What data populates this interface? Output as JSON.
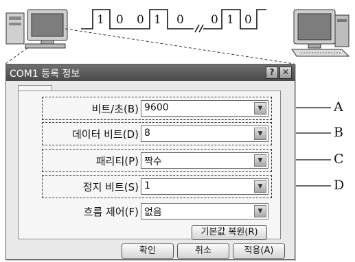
{
  "signal_bits": [
    "1",
    "0",
    "0",
    "1",
    "0",
    "0",
    "1",
    "0"
  ],
  "dialog": {
    "title": "COM1 등록 정보",
    "help_icon": "?",
    "close_icon": "✕",
    "fields": [
      {
        "label": "비트/초(B)",
        "value": "9600"
      },
      {
        "label": "데이터 비트(D)",
        "value": "8"
      },
      {
        "label": "패리티(P)",
        "value": "짝수"
      },
      {
        "label": "정지 비트(S)",
        "value": "1"
      },
      {
        "label": "흐름 제어(F)",
        "value": "없음"
      }
    ],
    "restore_button": "기본값 복원(R)",
    "ok_button": "확인",
    "cancel_button": "취소",
    "apply_button": "적용(A)"
  },
  "callouts": [
    "A",
    "B",
    "C",
    "D"
  ],
  "icons": {
    "computer_left": "desktop-computer-icon",
    "computer_right": "desktop-computer-icon",
    "dropdown": "chevron-down-icon"
  }
}
